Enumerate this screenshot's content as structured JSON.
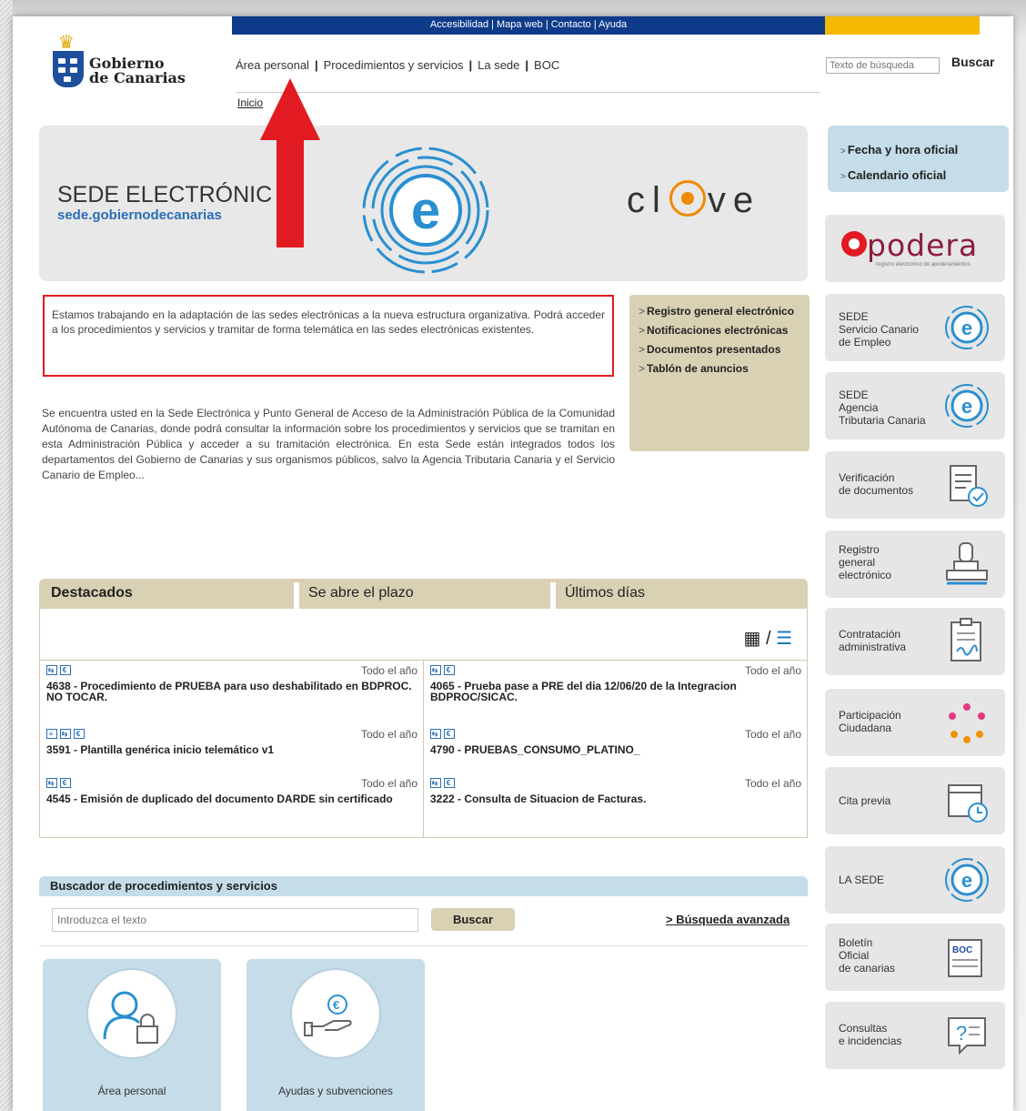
{
  "topbar": {
    "links": "Accesibilidad | Mapa web | Contacto | Ayuda"
  },
  "logo": {
    "line1": "Gobierno",
    "line2": "de Canarias"
  },
  "nav": {
    "items": [
      "Área personal",
      "Procedimientos y servicios",
      "La sede",
      "BOC"
    ],
    "breadcrumb": "Inicio"
  },
  "search": {
    "placeholder": "Texto de búsqueda",
    "button": "Buscar"
  },
  "banner": {
    "title": "SEDE ELECTRÓNIC",
    "url": "sede.gobiernodecanarias",
    "clave_left": "cl",
    "clave_right": "ve"
  },
  "notice": "Estamos trabajando en la adaptación de las sedes electrónicas a la nueva estructura organizativa. Podrá acceder a los procedimientos y servicios y tramitar de forma telemática en las sedes electrónicas existentes.",
  "intro": "Se encuentra usted en la Sede Electrónica y Punto General de Acceso de la Administración Pública de la Comunidad Autónoma de Canarias, donde podrá consultar la información sobre los procedimientos y servicios que se tramitan en esta Administración Pública y acceder a su tramitación electrónica. En esta Sede están integrados todos los departamentos del Gobierno de Canarias y sus organismos públicos, salvo la Agencia Tributaria Canaria y el Servicio Canario de Empleo...",
  "quick": [
    "Registro general electrónico",
    "Notificaciones electrónicas",
    "Documentos presentados",
    "Tablón de anuncios"
  ],
  "fecha": [
    "Fecha y hora oficial",
    "Calendario oficial"
  ],
  "sidebar": {
    "apodera": "podera",
    "apodera_sub": "registro electrónico de apoderamientos",
    "items": [
      {
        "label": "SEDE\nServicio Canario\nde Empleo",
        "icon": "sede-e-icon"
      },
      {
        "label": "SEDE\nAgencia\nTributaria Canaria",
        "icon": "sede-e-icon"
      },
      {
        "label": "Verificación\nde documentos",
        "icon": "document-check-icon"
      },
      {
        "label": "Registro\ngeneral\nelectrónico",
        "icon": "registry-stamp-icon"
      },
      {
        "label": "Contratación\nadministrativa",
        "icon": "contract-icon"
      },
      {
        "label": "Participación\nCiudadana",
        "icon": "people-icon"
      },
      {
        "label": "Cita previa",
        "icon": "calendar-clock-icon"
      },
      {
        "label": "LA SEDE",
        "icon": "sede-e-icon"
      },
      {
        "label": "Boletín\nOficial\nde canarias",
        "icon": "boc-icon"
      },
      {
        "label": "Consultas\ne incidencias",
        "icon": "question-icon"
      }
    ],
    "boc_badge": "BOC"
  },
  "tabs": [
    "Destacados",
    "Se abre el plazo",
    "Últimos días"
  ],
  "procedures": [
    {
      "title": "4638 - Procedimiento de PRUEBA para uso deshabilitado en BDPROC. NO TOCAR.",
      "when": "Todo el año"
    },
    {
      "title": "4065 - Prueba pase a PRE del dia 12/06/20 de la Integracion BDPROC/SICAC.",
      "when": "Todo el año"
    },
    {
      "title": "3591 - Plantilla genérica inicio telemático v1",
      "when": "Todo el año"
    },
    {
      "title": "4790 - PRUEBAS_CONSUMO_PLATINO_",
      "when": "Todo el año"
    },
    {
      "title": "4545 - Emisión de duplicado del documento DARDE sin certificado",
      "when": "Todo el año"
    },
    {
      "title": "3222 - Consulta de Situacion de Facturas.",
      "when": "Todo el año"
    }
  ],
  "searchbox": {
    "title": "Buscador de procedimientos y servicios",
    "placeholder": "Introduzca el texto",
    "button": "Buscar",
    "advanced": "> Búsqueda avanzada"
  },
  "tiles": [
    "Área personal",
    "Ayudas y subvenciones"
  ],
  "colors": {
    "navy": "#0e3a8a",
    "accent_red": "#e21b23",
    "tan": "#d8d1b4",
    "lightblue": "#c5dce9"
  }
}
